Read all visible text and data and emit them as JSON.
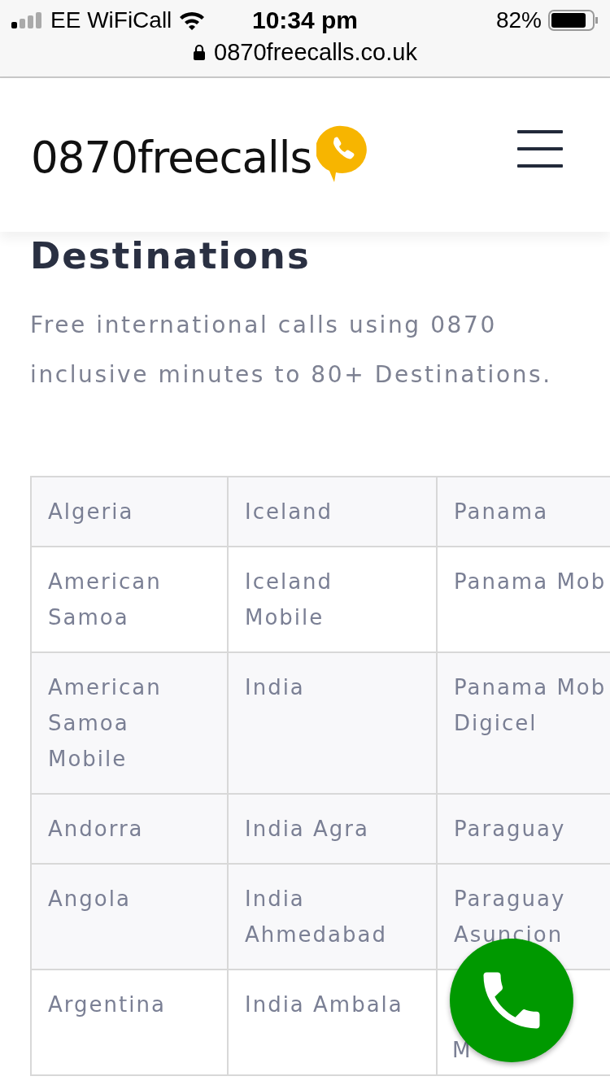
{
  "status_bar": {
    "carrier": "EE WiFiCall",
    "time": "10:34 pm",
    "battery": "82%"
  },
  "address_bar": {
    "url": "0870freecalls.co.uk"
  },
  "header": {
    "logo": "0870freecalls"
  },
  "page": {
    "title": "Destinations",
    "intro": "Free international calls using 0870 inclusive minutes to 80+ Destinations."
  },
  "table": {
    "rows": [
      [
        "Algeria",
        "Iceland",
        "Panama"
      ],
      [
        "American Samoa",
        "Iceland Mobile",
        "Panama Mob"
      ],
      [
        "American Samoa Mobile",
        "India",
        "Panama Mob\nDigicel"
      ],
      [
        "Andorra",
        "India Agra",
        "Paraguay"
      ],
      [
        "Angola",
        "India Ahmedabad",
        "Paraguay\nAsuncion"
      ],
      [
        "Argentina",
        "India Ambala",
        "M"
      ]
    ]
  }
}
